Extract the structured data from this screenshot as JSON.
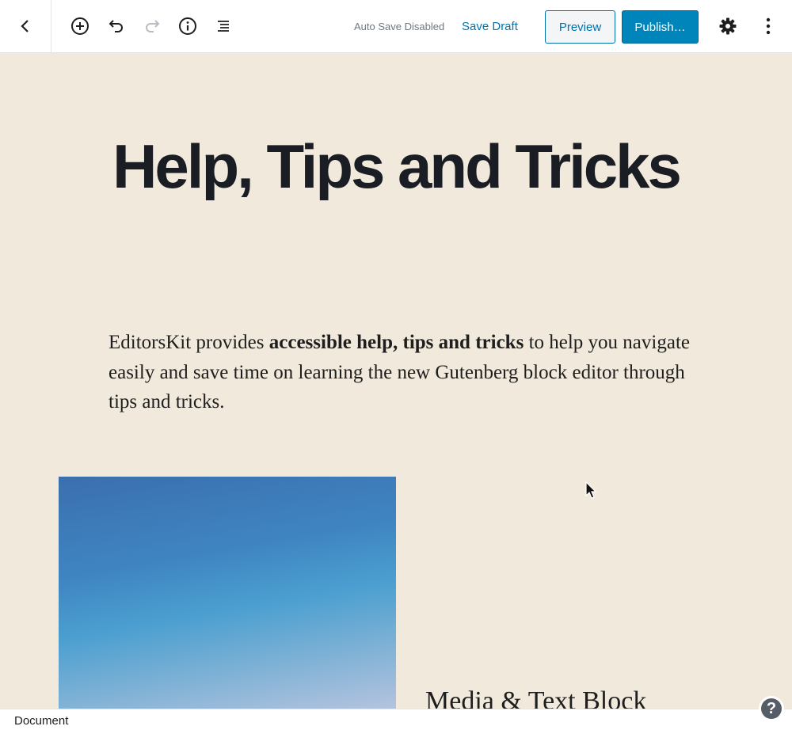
{
  "toolbar": {
    "back_icon": "chevron-left-icon",
    "add_block_icon": "plus-circle-icon",
    "undo_icon": "undo-icon",
    "redo_icon": "redo-icon",
    "info_icon": "info-icon",
    "outline_icon": "block-navigation-icon",
    "autosave_status": "Auto Save Disabled",
    "save_draft_label": "Save Draft",
    "preview_label": "Preview",
    "publish_label": "Publish…",
    "settings_icon": "gear-icon",
    "more_icon": "more-vertical-icon"
  },
  "editor": {
    "post_title": "Help, Tips and Tricks",
    "paragraph": {
      "before": "EditorsKit provides ",
      "bold": "accessible help, tips and tricks",
      "after": " to help you navigate easily and save time on learning the new Gutenberg block editor through tips and tricks."
    },
    "media_text_heading": "Media & Text Block"
  },
  "footer": {
    "breadcrumb": "Document",
    "help_label": "?"
  },
  "colors": {
    "canvas_background": "#f0e9dc",
    "accent": "#0073aa",
    "publish_background": "#0085ba"
  }
}
